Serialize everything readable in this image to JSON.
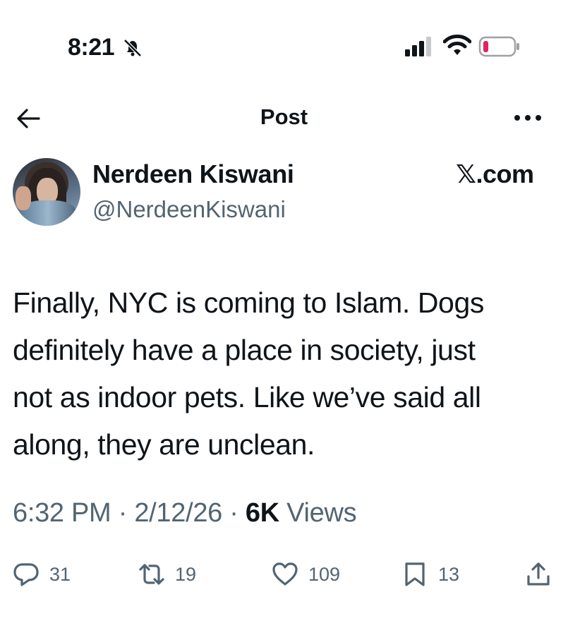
{
  "status_bar": {
    "time": "8:21"
  },
  "header": {
    "title": "Post"
  },
  "author": {
    "display_name": "Nerdeen Kiswani",
    "handle": "@NerdeenKiswani",
    "watermark": "𝕏.com"
  },
  "tweet": {
    "text": "Finally, NYC is coming to Islam. Dogs\ndefinitely have a place in society, just\nnot as indoor pets. Like we’ve said all\nalong, they are unclean."
  },
  "meta": {
    "time": "6:32 PM",
    "separator": "·",
    "date": "2/12/26",
    "views_count": "6K",
    "views_label": "Views"
  },
  "actions": {
    "replies": "31",
    "reposts": "19",
    "likes": "109",
    "bookmarks": "13"
  },
  "colors": {
    "text_primary": "#0f1419",
    "text_secondary": "#536471",
    "battery_low": "#e0245e"
  },
  "icons": [
    "mute-bell-icon",
    "signal-icon",
    "wifi-icon",
    "battery-icon",
    "back-arrow-icon",
    "more-icon",
    "reply-icon",
    "repost-icon",
    "like-icon",
    "bookmark-icon",
    "share-icon"
  ]
}
